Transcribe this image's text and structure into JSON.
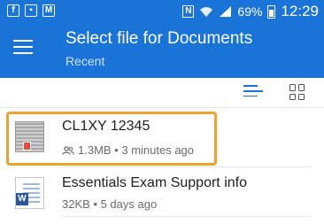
{
  "status_bar": {
    "left_icons": [
      "facebook-icon",
      "gallery-icon",
      "gmail-icon"
    ],
    "nfc_label": "N",
    "battery": "69%",
    "time": "12:29"
  },
  "app_bar": {
    "title": "Select file for Documents",
    "subtitle": "Recent"
  },
  "toolbar": {
    "icons": [
      "list-view-icon",
      "grid-view-icon"
    ]
  },
  "files": [
    {
      "name": "CL1XY 12345",
      "shared": true,
      "meta": "1.3MB • 3 minutes ago",
      "highlighted": true,
      "highlight_color": "#f0a22e",
      "thumbnail": "image-thumbnail"
    },
    {
      "name": "Essentials Exam Support info",
      "shared": false,
      "meta": "32KB • 5 days ago",
      "thumbnail": "word-document-icon",
      "badge_label": "W"
    }
  ],
  "colors": {
    "accent": "#1a73d6",
    "highlight": "#f0a22e"
  }
}
